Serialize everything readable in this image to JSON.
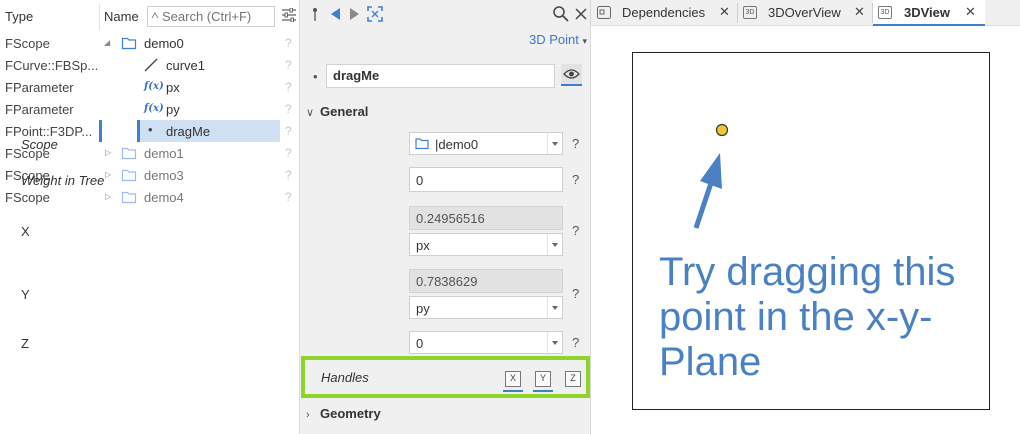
{
  "tree": {
    "header_type": "Type",
    "header_name": "Name",
    "search_placeholder": "Search (Ctrl+F)",
    "rows": [
      {
        "type": "FScope",
        "name": "demo0",
        "q": "?"
      },
      {
        "type": "FCurve::FBSp...",
        "name": "curve1",
        "q": "?"
      },
      {
        "type": "FParameter",
        "name": "px",
        "q": "?"
      },
      {
        "type": "FParameter",
        "name": "py",
        "q": "?"
      },
      {
        "type": "FPoint::F3DP...",
        "name": "dragMe",
        "q": "?"
      },
      {
        "type": "FScope",
        "name": "demo1",
        "q": "?"
      },
      {
        "type": "FScope",
        "name": "demo3",
        "q": "?"
      },
      {
        "type": "FScope",
        "name": "demo4",
        "q": "?"
      }
    ]
  },
  "inspector": {
    "kind": "3D Point",
    "name": "dragMe",
    "general_label": "General",
    "geometry_label": "Geometry",
    "scope_label": "Scope",
    "scope_value": "|demo0",
    "weight_label": "Weight in Tree",
    "weight_value": "0",
    "x_label": "X",
    "x_value": "0.24956516",
    "x_param": "px",
    "y_label": "Y",
    "y_value": "0.7838629",
    "y_param": "py",
    "z_label": "Z",
    "z_value": "0",
    "handles_label": "Handles",
    "handle_x": "X",
    "handle_y": "Y",
    "handle_z": "Z",
    "help": "?"
  },
  "tabs": [
    {
      "label": "Dependencies",
      "icon": "graph-icon"
    },
    {
      "label": "3DOverView",
      "icon": "3d-icon"
    },
    {
      "label": "3DView",
      "icon": "3d-icon",
      "active": true
    }
  ],
  "view": {
    "instruction": "Try dragging this point in the x-y-Plane",
    "point_color": "#f4c430"
  },
  "colors": {
    "accent": "#3f7fd0",
    "highlight_border": "#8ed42a",
    "selection": "#cfe0f3"
  }
}
